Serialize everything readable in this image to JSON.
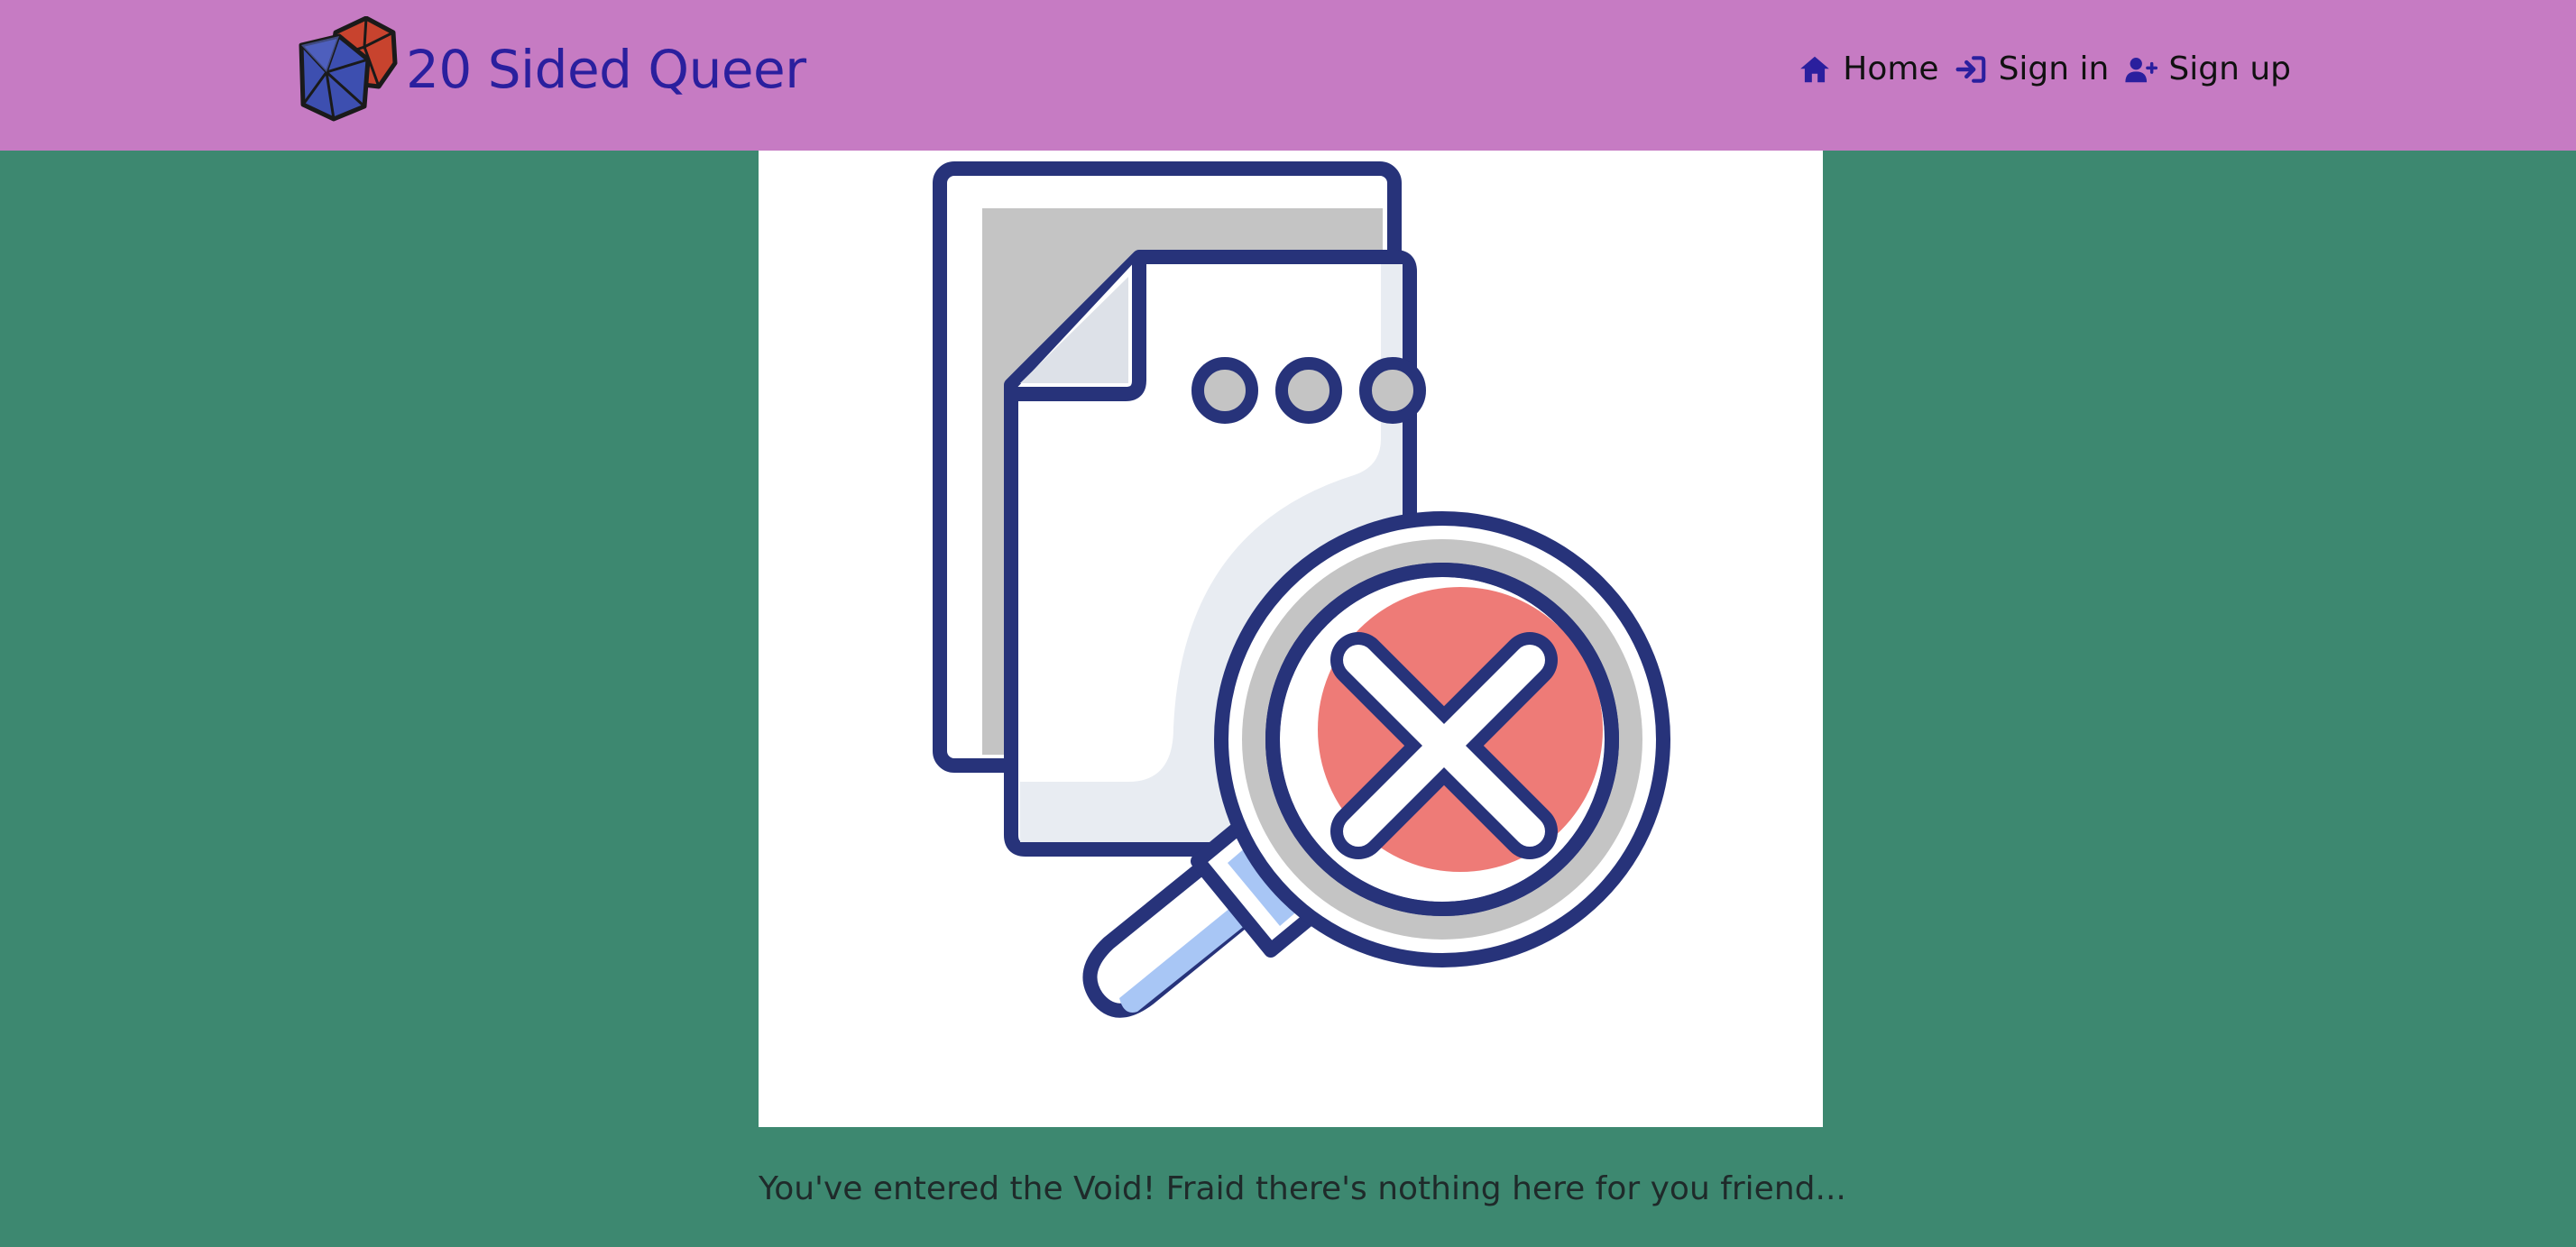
{
  "navbar": {
    "brand": {
      "title": "20 Sided Queer",
      "logo_icon": "d20-dice-icon"
    },
    "links": [
      {
        "label": "Home",
        "icon": "home-icon"
      },
      {
        "label": "Sign in",
        "icon": "sign-in-icon"
      },
      {
        "label": "Sign up",
        "icon": "user-plus-icon"
      }
    ],
    "colors": {
      "background": "#c67bc3",
      "brand_text": "#2a1f9e",
      "icon": "#2a1f9e"
    }
  },
  "page": {
    "background": "#3d8870",
    "illustration": "document-not-found-magnifier-icon",
    "message": "You've entered the Void! Fraid there's nothing here for you friend..."
  }
}
